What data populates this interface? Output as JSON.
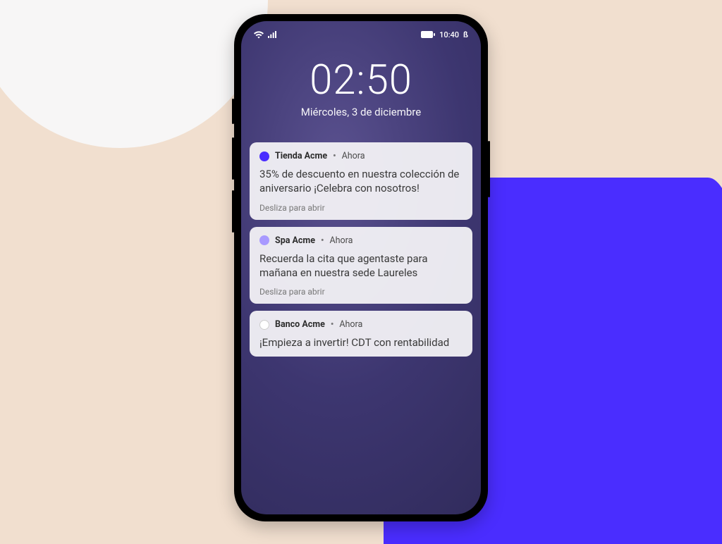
{
  "status": {
    "left_icons": [
      "wifi",
      "signal"
    ],
    "battery_icon": "battery",
    "time": "10:40",
    "bt_label": "ß"
  },
  "lock": {
    "clock": "02:50",
    "date": "Miércoles, 3 de diciembre"
  },
  "notifications": [
    {
      "icon_color": "#4a2dff",
      "app": "Tienda Acme",
      "when": "Ahora",
      "body": "35% de descuento en nuestra colección de aniversario ¡Celebra con nosotros!",
      "hint": "Desliza para abrir"
    },
    {
      "icon_color": "#a899ff",
      "app": "Spa Acme",
      "when": "Ahora",
      "body": "Recuerda la cita que agentaste para mañana en nuestra sede Laureles",
      "hint": "Desliza para abrir"
    },
    {
      "icon_color": "#ffffff",
      "app": "Banco Acme",
      "when": "Ahora",
      "body": "¡Empieza a invertir! CDT con rentabilidad",
      "hint": ""
    }
  ]
}
